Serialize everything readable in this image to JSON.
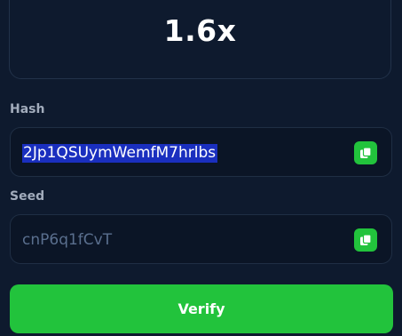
{
  "result": {
    "multiplier": "1.6x"
  },
  "hash": {
    "label": "Hash",
    "value": "2Jp1QSUymWemfM7hrlbs"
  },
  "seed": {
    "label": "Seed",
    "value": "cnP6q1fCvT"
  },
  "actions": {
    "verify_label": "Verify"
  },
  "icons": {
    "copy": "copy-icon"
  },
  "colors": {
    "background": "#0e1a2e",
    "accent": "#22c33c",
    "selection": "#1a2fbf",
    "label": "#a2acbc"
  }
}
